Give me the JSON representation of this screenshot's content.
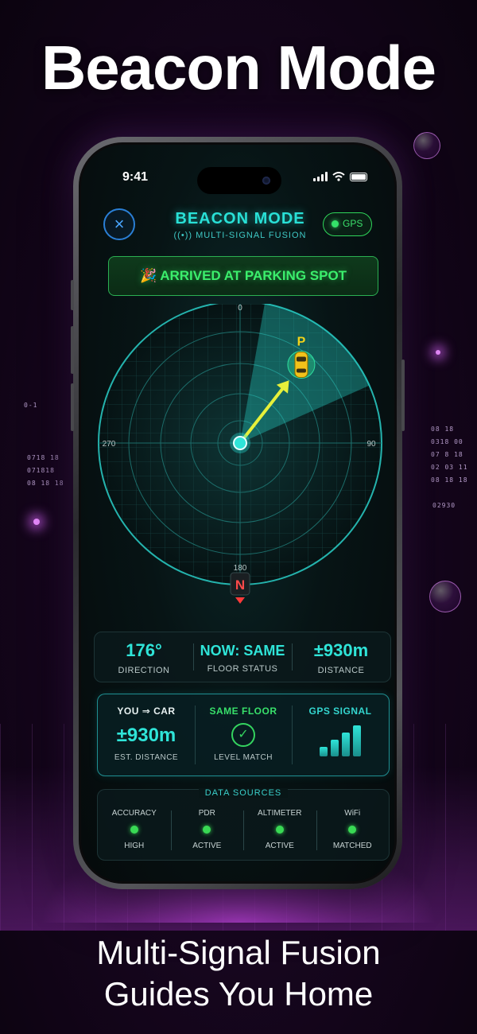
{
  "headline": "Beacon Mode",
  "tagline": [
    "Multi-Signal Fusion",
    "Guides You Home"
  ],
  "status_bar": {
    "time": "9:41"
  },
  "header": {
    "title": "BEACON MODE",
    "subtitle": "((•)) MULTI-SIGNAL FUSION",
    "close_icon": "×",
    "gps_label": "GPS"
  },
  "banner": {
    "text": "🎉 ARRIVED AT PARKING SPOT"
  },
  "radar": {
    "bearing_labels": {
      "top": "0",
      "right": "90",
      "bottom": "180",
      "left": "270"
    },
    "north_label": "N",
    "target_label": "P",
    "target_bearing_deg": 38
  },
  "stats": [
    {
      "value": "176°",
      "label": "DIRECTION"
    },
    {
      "value": "NOW: SAME",
      "label": "FLOOR STATUS"
    },
    {
      "value": "±930m",
      "label": "DISTANCE"
    }
  ],
  "info": {
    "you_car": {
      "title": "YOU ⇒ CAR",
      "value": "±930m",
      "caption": "EST. DISTANCE"
    },
    "floor": {
      "title": "SAME FLOOR",
      "icon": "✓",
      "caption": "LEVEL MATCH"
    },
    "gps": {
      "title": "GPS SIGNAL",
      "bars_level": 4,
      "bars_total": 4
    }
  },
  "sources": {
    "title": "DATA SOURCES",
    "items": [
      {
        "name": "ACCURACY",
        "status": "HIGH"
      },
      {
        "name": "PDR",
        "status": "ACTIVE"
      },
      {
        "name": "ALTIMETER",
        "status": "ACTIVE"
      },
      {
        "name": "WiFi",
        "status": "MATCHED"
      }
    ]
  },
  "side_codes": {
    "left_1": "0-1",
    "left_2": "0718 18",
    "left_3": "071818",
    "left_4": "08 18 18",
    "right_1": "08 18",
    "right_2": "0318 00",
    "right_3": "07 8 18",
    "right_4": "02 03 11",
    "right_5": "08 18 18",
    "right_6": "02930"
  },
  "colors": {
    "accent": "#2fe4d8",
    "success": "#3bee6c",
    "close": "#4aa6ff"
  }
}
